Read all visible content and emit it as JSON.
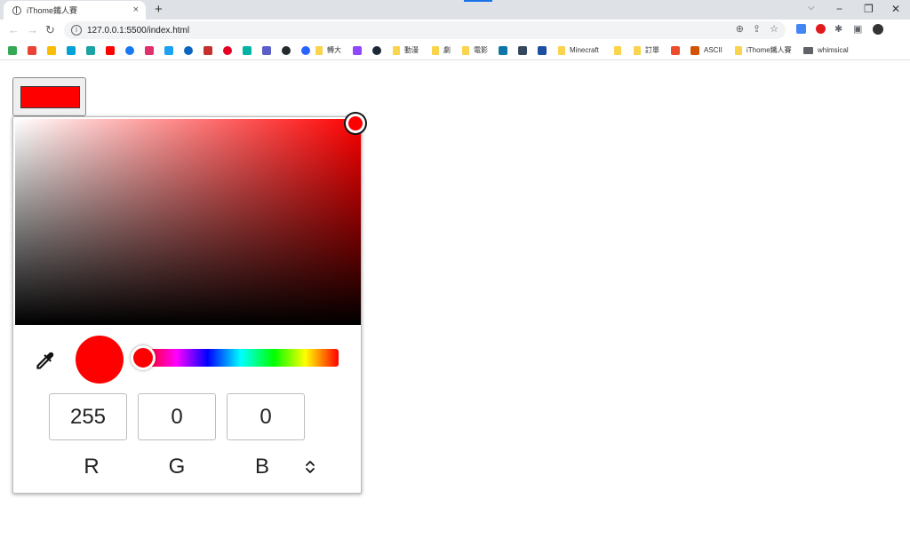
{
  "browser": {
    "tab": {
      "title": "iThome鐵人賽",
      "close": "×"
    },
    "new_tab": "+",
    "url": "127.0.0.1:5500/index.html",
    "window_controls": {
      "minimize": "−",
      "restore": "❐",
      "close": "✕"
    },
    "tab_search": "⌵"
  },
  "bookmarks": [
    {
      "label": "轉大",
      "color": "#f9d44c"
    },
    {
      "label": "動漫",
      "color": "#f9d44c"
    },
    {
      "label": "劇",
      "color": "#f9d44c"
    },
    {
      "label": "電影",
      "color": "#f9d44c"
    },
    {
      "label": "Minecraft",
      "color": "#f9d44c"
    },
    {
      "label": "訂單",
      "color": "#f9d44c"
    },
    {
      "label": "ASCII",
      "color": "#f9d44c"
    },
    {
      "label": "iThome鐵人賽",
      "color": "#f9d44c"
    },
    {
      "label": "whimsical",
      "color": "#5f6368"
    }
  ],
  "picker": {
    "current_color": "#ff0000",
    "hue_color": "#ff0000",
    "hue_position": 0,
    "saturation": 1,
    "value": 1,
    "channels": [
      {
        "value": "255",
        "label": "R"
      },
      {
        "value": "0",
        "label": "G"
      },
      {
        "value": "0",
        "label": "B"
      }
    ],
    "toggle_icon": "chevron-up-down-icon",
    "eyedropper_icon": "eyedropper-icon"
  }
}
